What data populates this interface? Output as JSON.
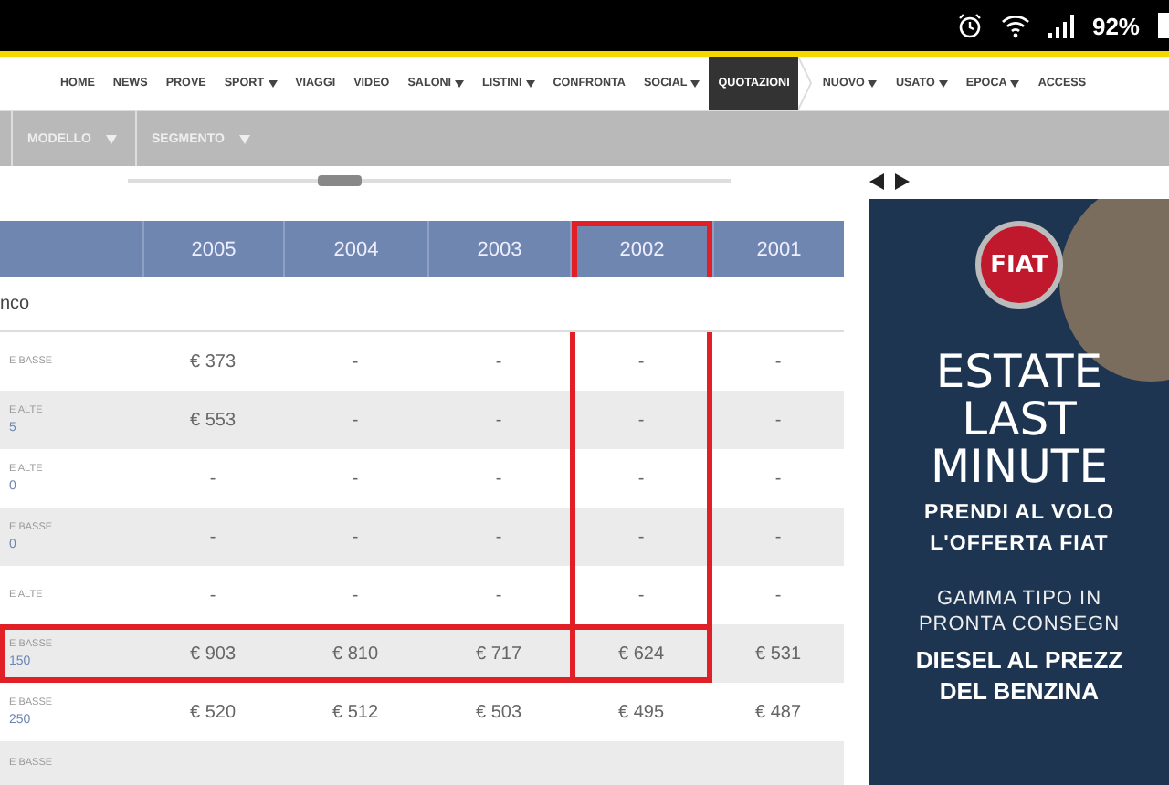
{
  "status_bar": {
    "battery": "92%"
  },
  "nav": {
    "items": [
      {
        "label": "HOME",
        "has_menu": false,
        "selected": false
      },
      {
        "label": "NEWS",
        "has_menu": false,
        "selected": false
      },
      {
        "label": "PROVE",
        "has_menu": false,
        "selected": false
      },
      {
        "label": "SPORT",
        "has_menu": true,
        "selected": false
      },
      {
        "label": "VIAGGI",
        "has_menu": false,
        "selected": false
      },
      {
        "label": "VIDEO",
        "has_menu": false,
        "selected": false
      },
      {
        "label": "SALONI",
        "has_menu": true,
        "selected": false
      },
      {
        "label": "LISTINI",
        "has_menu": true,
        "selected": false
      },
      {
        "label": "CONFRONTA",
        "has_menu": false,
        "selected": false
      },
      {
        "label": "SOCIAL",
        "has_menu": true,
        "selected": false
      },
      {
        "label": "QUOTAZIONI",
        "has_menu": false,
        "selected": true
      },
      {
        "label": "NUOVO",
        "has_menu": true,
        "selected": false
      },
      {
        "label": "USATO",
        "has_menu": true,
        "selected": false
      },
      {
        "label": "EPOCA",
        "has_menu": true,
        "selected": false
      },
      {
        "label": "ACCESS",
        "has_menu": false,
        "selected": false
      }
    ]
  },
  "filters": [
    "MODELLO",
    "SEGMENTO"
  ],
  "table": {
    "columns": [
      {
        "label": "2005",
        "highlighted": false
      },
      {
        "label": "2004",
        "highlighted": false
      },
      {
        "label": "2003",
        "highlighted": false
      },
      {
        "label": "2002",
        "highlighted": true
      },
      {
        "label": "2001",
        "highlighted": false
      }
    ],
    "group": "nco",
    "rows": [
      {
        "label": "E BASSE",
        "sub": "",
        "highlighted": false,
        "values": [
          "€ 373",
          "-",
          "-",
          "-",
          "-"
        ]
      },
      {
        "label": "E ALTE",
        "sub": "5",
        "highlighted": false,
        "values": [
          "€ 553",
          "-",
          "-",
          "-",
          "-"
        ]
      },
      {
        "label": "E ALTE",
        "sub": "0",
        "highlighted": false,
        "values": [
          "-",
          "-",
          "-",
          "-",
          "-"
        ]
      },
      {
        "label": "E BASSE",
        "sub": "0",
        "highlighted": false,
        "values": [
          "-",
          "-",
          "-",
          "-",
          "-"
        ]
      },
      {
        "label": "E ALTE",
        "sub": "",
        "highlighted": false,
        "values": [
          "-",
          "-",
          "-",
          "-",
          "-"
        ]
      },
      {
        "label": "E BASSE",
        "sub": "150",
        "highlighted": true,
        "values": [
          "€ 903",
          "€ 810",
          "€ 717",
          "€ 624",
          "€ 531"
        ]
      },
      {
        "label": "E BASSE",
        "sub": "250",
        "highlighted": false,
        "values": [
          "€ 520",
          "€ 512",
          "€ 503",
          "€ 495",
          "€ 487"
        ]
      },
      {
        "label": "E BASSE",
        "sub": "",
        "highlighted": false,
        "values": []
      }
    ]
  },
  "ad": {
    "logo": "FIAT",
    "headline": [
      "ESTATE",
      "LAST",
      "MINUTE"
    ],
    "subhead": [
      "PRENDI AL VOLO",
      "L'OFFERTA FIAT"
    ],
    "offer": [
      "GAMMA TIPO IN",
      "PRONTA CONSEGN"
    ],
    "claim": [
      "DIESEL AL PREZZ",
      "DEL BENZINA"
    ]
  }
}
